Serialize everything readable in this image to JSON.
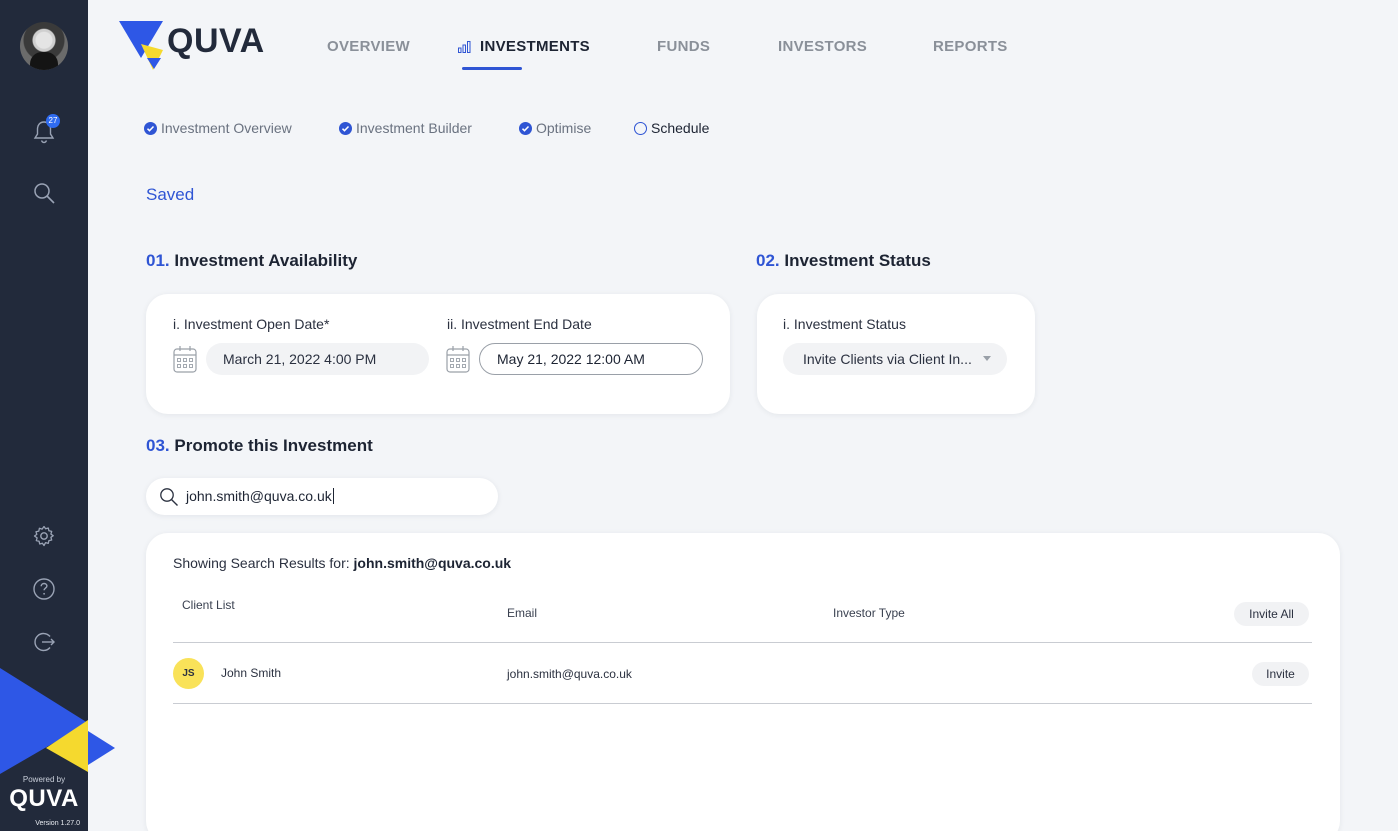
{
  "sidebar": {
    "notification_count": "27",
    "powered_by": "Powered by",
    "brand": "QUVA",
    "version": "Version 1.27.0"
  },
  "header": {
    "logo_text": "QUVA",
    "nav": [
      {
        "label": "OVERVIEW",
        "active": false
      },
      {
        "label": "INVESTMENTS",
        "active": true
      },
      {
        "label": "FUNDS",
        "active": false
      },
      {
        "label": "INVESTORS",
        "active": false
      },
      {
        "label": "REPORTS",
        "active": false
      }
    ]
  },
  "steps": [
    {
      "label": "Investment Overview",
      "done": true
    },
    {
      "label": "Investment Builder",
      "done": true
    },
    {
      "label": "Optimise",
      "done": true
    },
    {
      "label": "Schedule",
      "done": false
    }
  ],
  "status_text": "Saved",
  "availability": {
    "num": "01.",
    "title": "Investment Availability",
    "open_label": "i. Investment Open Date*",
    "open_value": "March 21, 2022 4:00 PM",
    "end_label": "ii. Investment End Date",
    "end_value": "May 21, 2022 12:00 AM"
  },
  "status_section": {
    "num": "02.",
    "title": "Investment Status",
    "field_label": "i. Investment Status",
    "selected": "Invite Clients via Client In..."
  },
  "promote": {
    "num": "03.",
    "title": "Promote this Investment",
    "search_value": "john.smith@quva.co.uk",
    "results_prefix": "Showing Search Results for:",
    "results_query": "john.smith@quva.co.uk",
    "columns": [
      "Client List",
      "Email",
      "Investor Type"
    ],
    "invite_all_label": "Invite All",
    "rows": [
      {
        "initials": "JS",
        "name": "John Smith",
        "email": "john.smith@quva.co.uk",
        "investor_type": "",
        "action": "Invite"
      }
    ]
  },
  "colors": {
    "sidebar_bg": "#222a3b",
    "accent_blue": "#2f55d4",
    "logo_blue": "#2e57e6",
    "logo_yellow": "#f5d92e",
    "avatar_yellow": "#f9e259"
  }
}
